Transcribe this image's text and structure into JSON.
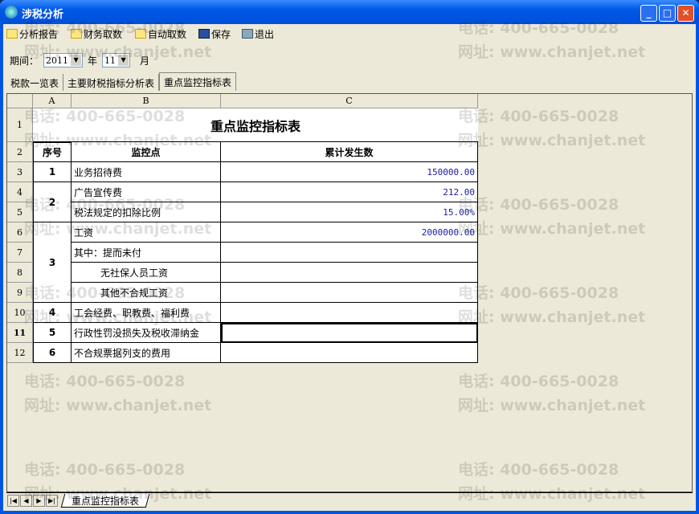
{
  "window": {
    "title": "涉税分析",
    "minimize": "_",
    "maximize": "□",
    "close": "✕"
  },
  "toolbar": [
    {
      "label": "分析报告",
      "icon": "report-icon"
    },
    {
      "label": "财务取数",
      "icon": "fetch-icon"
    },
    {
      "label": "自动取数",
      "icon": "auto-fetch-icon"
    },
    {
      "label": "保存",
      "icon": "save-icon"
    },
    {
      "label": "退出",
      "icon": "exit-icon"
    }
  ],
  "period": {
    "label": "期间：",
    "year": "2011",
    "year_unit": "年",
    "month": "11",
    "month_unit": "月"
  },
  "tabs": [
    {
      "label": "税款一览表"
    },
    {
      "label": "主要财税指标分析表"
    },
    {
      "label": "重点监控指标表",
      "active": true
    }
  ],
  "grid": {
    "columns": [
      "A",
      "B",
      "C"
    ],
    "rows": [
      "1",
      "2",
      "3",
      "4",
      "5",
      "6",
      "7",
      "8",
      "9",
      "10",
      "11",
      "12"
    ],
    "title": "重点监控指标表",
    "headers": [
      "序号",
      "监控点",
      "累计发生数"
    ],
    "items": [
      {
        "no": "1",
        "point": "业务招待费",
        "value": "150000.00"
      },
      {
        "no": "2",
        "point": "广告宣传费",
        "value": "212.00"
      },
      {
        "no": "",
        "point": "税法规定的扣除比例",
        "value": "15.00%"
      },
      {
        "no": "3",
        "point": "工资",
        "value": "2000000.00"
      },
      {
        "no": "",
        "point": "其中：提而未付",
        "value": ""
      },
      {
        "no": "",
        "point": "无社保人员工资",
        "value": ""
      },
      {
        "no": "",
        "point": "其他不合规工资",
        "value": ""
      },
      {
        "no": "4",
        "point": "工会经费、职教费、福利费",
        "value": ""
      },
      {
        "no": "5",
        "point": "行政性罚没损失及税收滞纳金",
        "value": ""
      },
      {
        "no": "6",
        "point": "不合规票据列支的费用",
        "value": ""
      }
    ]
  },
  "sheet_tabs": {
    "nav": [
      "|◀",
      "◀",
      "▶",
      "▶|"
    ],
    "active": "重点监控指标表"
  },
  "watermark": {
    "phone": "电话: 400-665-0028",
    "site": "网址: www.chanjet.net"
  }
}
